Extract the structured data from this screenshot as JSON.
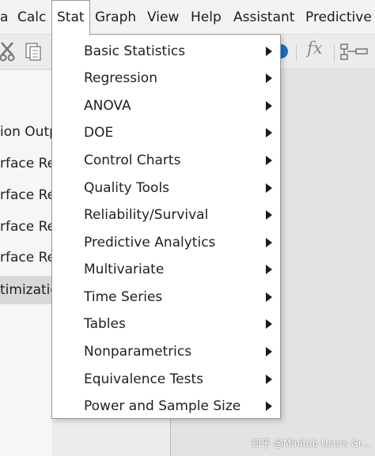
{
  "menubar": {
    "items": [
      "a",
      "Calc",
      "Stat",
      "Graph",
      "View",
      "Help",
      "Assistant",
      "Predictive"
    ],
    "active": "Stat"
  },
  "toolbar": {
    "icons": [
      "cut-icon",
      "paste-icon",
      "help-circle-icon",
      "formula-icon",
      "layout-icon"
    ],
    "formula_glyph": "fx"
  },
  "leftpane": {
    "rows": [
      "ion Outp",
      "rface Reg",
      "rface Reg",
      "rface Reg",
      "rface Reg",
      "timization"
    ],
    "selected_index": 5
  },
  "stat_menu": {
    "items": [
      "Basic Statistics",
      "Regression",
      "ANOVA",
      "DOE",
      "Control Charts",
      "Quality Tools",
      "Reliability/Survival",
      "Predictive Analytics",
      "Multivariate",
      "Time Series",
      "Tables",
      "Nonparametrics",
      "Equivalence Tests",
      "Power and Sample Size"
    ]
  },
  "watermark": "知乎 @Minitab Users Gr...",
  "colors": {
    "menu_bg": "#ffffff",
    "menubar_bg": "#f3f3f3",
    "help_icon_blue": "#1a73c8"
  }
}
